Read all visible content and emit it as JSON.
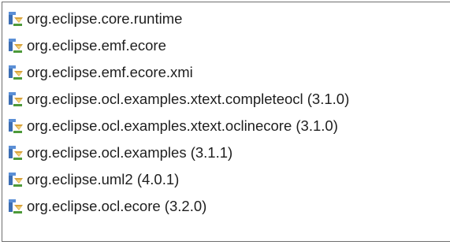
{
  "dependencies": {
    "items": [
      {
        "label": "org.eclipse.core.runtime",
        "icon": "plugin-package-icon"
      },
      {
        "label": "org.eclipse.emf.ecore",
        "icon": "plugin-package-icon"
      },
      {
        "label": "org.eclipse.emf.ecore.xmi",
        "icon": "plugin-package-icon"
      },
      {
        "label": "org.eclipse.ocl.examples.xtext.completeocl (3.1.0)",
        "icon": "plugin-package-icon"
      },
      {
        "label": "org.eclipse.ocl.examples.xtext.oclinecore (3.1.0)",
        "icon": "plugin-package-icon"
      },
      {
        "label": "org.eclipse.ocl.examples (3.1.1)",
        "icon": "plugin-package-icon"
      },
      {
        "label": "org.eclipse.uml2 (4.0.1)",
        "icon": "plugin-package-icon"
      },
      {
        "label": "org.eclipse.ocl.ecore (3.2.0)",
        "icon": "plugin-package-icon"
      }
    ]
  },
  "colors": {
    "text": "#1e1e1e",
    "border": "#6f6f6f",
    "icon_blue": "#3c6eb4",
    "icon_gold": "#d8a23a",
    "icon_green": "#4d9a3a"
  }
}
